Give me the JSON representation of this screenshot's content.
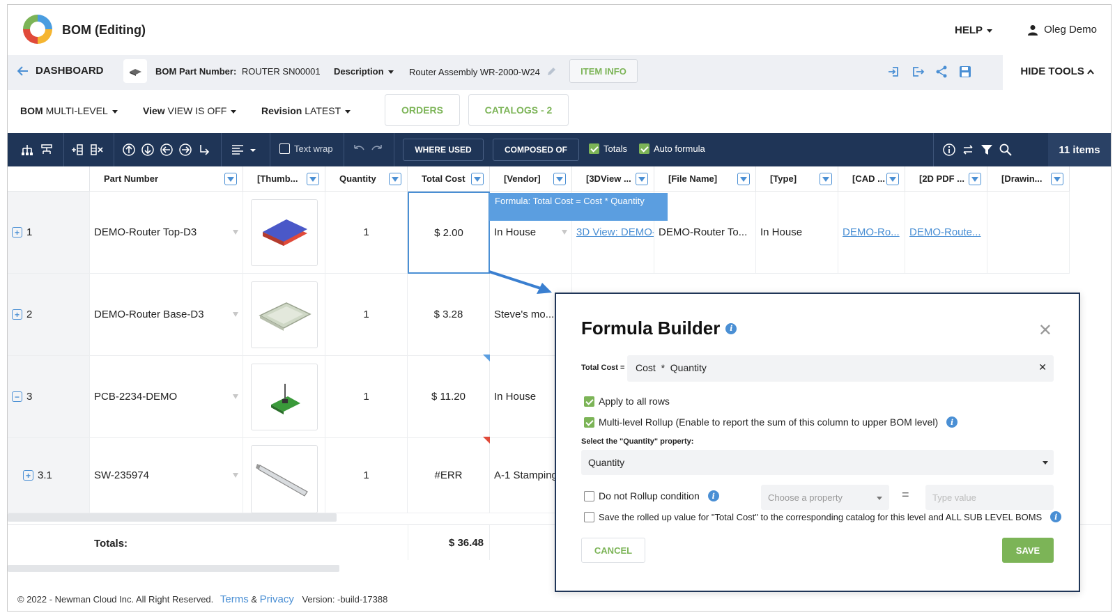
{
  "header": {
    "app_title": "BOM (Editing)",
    "help_label": "HELP",
    "user_name": "Oleg Demo"
  },
  "partbar": {
    "dashboard_label": "DASHBOARD",
    "part_number_label": "BOM Part Number:",
    "part_number_value": "ROUTER SN00001",
    "description_label": "Description",
    "description_value": "Router Assembly WR-2000-W24",
    "item_info_label": "ITEM INFO",
    "hide_tools_label": "HIDE TOOLS"
  },
  "settings": {
    "bom_label": "BOM",
    "bom_value": "MULTI-LEVEL",
    "view_label": "View",
    "view_value": "VIEW IS OFF",
    "revision_label": "Revision",
    "revision_value": "LATEST",
    "orders_label": "ORDERS",
    "catalogs_label": "CATALOGS - 2"
  },
  "toolbar": {
    "text_wrap_label": "Text wrap",
    "where_used_label": "WHERE USED",
    "composed_of_label": "COMPOSED OF",
    "totals_label": "Totals",
    "auto_formula_label": "Auto formula",
    "items_count": "11 items"
  },
  "grid": {
    "columns": [
      "Part Number",
      "[Thumb...",
      "Quantity",
      "Total Cost",
      "[Vendor]",
      "[3DView ...",
      "[File Name]",
      "[Type]",
      "[CAD ...",
      "[2D PDF ...",
      "[Drawin..."
    ],
    "formula_tooltip": "Formula: Total Cost = Cost * Quantity",
    "rows": [
      {
        "id": "1",
        "expand": "+",
        "part": "DEMO-Router Top-D3",
        "qty": "1",
        "cost": "$ 2.00",
        "vendor": "In House",
        "view3d": "3D View: DEMO-",
        "file": "DEMO-Router To...",
        "type": "In House",
        "cad": "DEMO-Ro...",
        "pdf": "DEMO-Route..."
      },
      {
        "id": "2",
        "expand": "+",
        "part": "DEMO-Router Base-D3",
        "qty": "1",
        "cost": "$ 3.28",
        "vendor": "Steve's mo..."
      },
      {
        "id": "3",
        "expand": "−",
        "part": "PCB-2234-DEMO",
        "qty": "1",
        "cost": "$ 11.20",
        "vendor": "In House"
      },
      {
        "id": "3.1",
        "expand": "+",
        "part": "SW-235974",
        "qty": "1",
        "cost": "#ERR",
        "vendor": "A-1 Stamping"
      }
    ],
    "totals_label": "Totals:",
    "totals_value": "$ 36.48"
  },
  "footer": {
    "copyright": "© 2022 - Newman Cloud Inc. All Right Reserved.",
    "terms": "Terms",
    "amp": "&",
    "privacy": "Privacy",
    "version": "Version: -build-17388"
  },
  "modal": {
    "title": "Formula Builder",
    "formula_label": "Total Cost =",
    "formula_value": "Cost  *  Quantity",
    "apply_all": "Apply to all rows",
    "multi_level": "Multi-level Rollup (Enable to report the sum of this column to upper BOM level)",
    "select_label": "Select the \"Quantity\" property:",
    "select_value": "Quantity",
    "no_rollup": "Do not Rollup condition",
    "property_placeholder": "Choose a property",
    "equals": "=",
    "value_placeholder": "Type value",
    "save_rolled": "Save the rolled up value for \"Total Cost\" to the corresponding catalog for this level and ALL SUB LEVEL BOMS",
    "cancel_label": "CANCEL",
    "save_label": "SAVE"
  },
  "colors": {
    "accent": "#4a8fd4",
    "toolbar": "#1f3557",
    "green": "#7cb457"
  }
}
